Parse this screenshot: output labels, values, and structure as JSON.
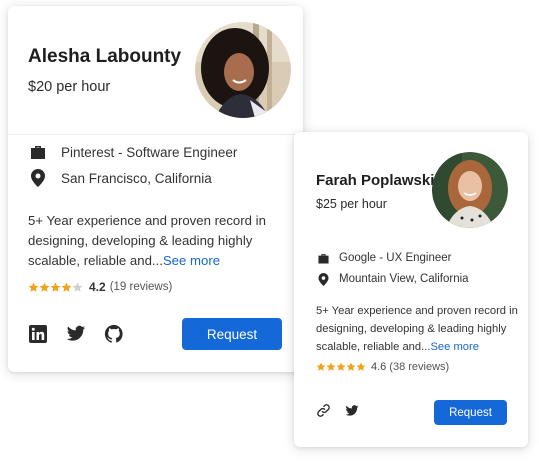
{
  "colors": {
    "accent": "#1468d8",
    "link": "#1666d3",
    "star": "#f3a11b",
    "star_empty": "#cfcfcf",
    "text": "#222222"
  },
  "profiles": [
    {
      "name": "Alesha Labounty",
      "rate": "$20 per hour",
      "company_icon": "briefcase-icon",
      "company": "Pinterest - Software Engineer",
      "location_icon": "location-pin-icon",
      "location": "San Francisco, California",
      "description": "5+ Year experience and proven record in designing, developing & leading highly scalable, reliable and...",
      "see_more": "See more",
      "rating_stars": 4,
      "rating_value": "4.2",
      "reviews": "(19 reviews)",
      "social_icons": [
        "linkedin-icon",
        "twitter-icon",
        "github-icon"
      ],
      "button_label": "Request"
    },
    {
      "name": "Farah Poplawski",
      "rate": "$25 per hour",
      "company_icon": "briefcase-icon",
      "company": "Google - UX Engineer",
      "location_icon": "location-pin-icon",
      "location": "Mountain View, California",
      "description": "5+ Year experience and proven record in designing, developing & leading highly scalable, reliable and...",
      "see_more": "See more",
      "rating_stars": 5,
      "rating_value": "4.6",
      "reviews": "(38 reviews)",
      "social_icons": [
        "link-icon",
        "twitter-icon"
      ],
      "button_label": "Request"
    }
  ]
}
